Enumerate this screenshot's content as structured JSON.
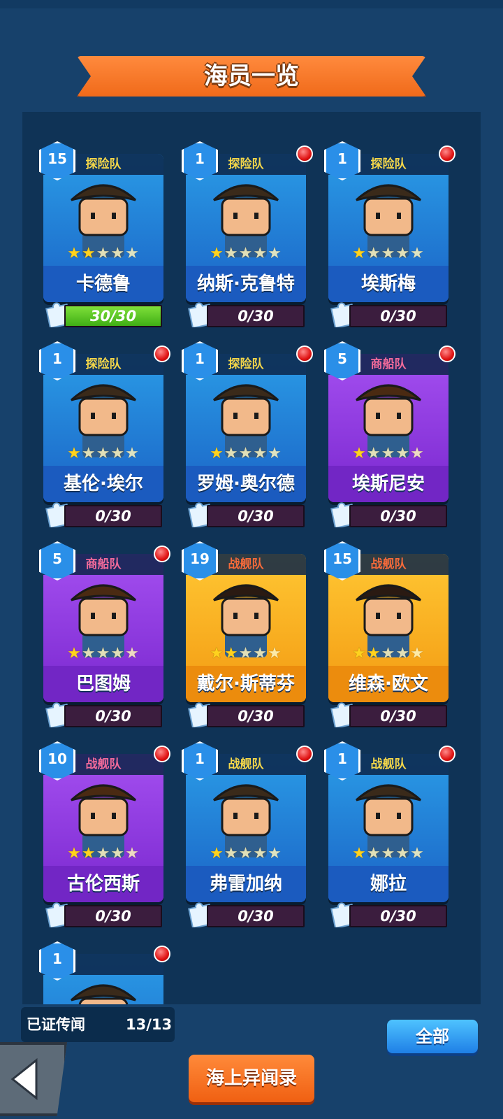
{
  "title": "海员一览",
  "crew": [
    {
      "level": "15",
      "team": "探险队",
      "team_color": "blue",
      "name": "卡德鲁",
      "stars": 2,
      "progress": "30/30",
      "progress_fraction": 1.0,
      "badge": false
    },
    {
      "level": "1",
      "team": "探险队",
      "team_color": "blue",
      "name": "纳斯·克鲁特",
      "stars": 1,
      "progress": "0/30",
      "progress_fraction": 0.0,
      "badge": true
    },
    {
      "level": "1",
      "team": "探险队",
      "team_color": "blue",
      "name": "埃斯梅",
      "stars": 1,
      "progress": "0/30",
      "progress_fraction": 0.0,
      "badge": true
    },
    {
      "level": "1",
      "team": "探险队",
      "team_color": "blue",
      "name": "基伦·埃尔",
      "stars": 1,
      "progress": "0/30",
      "progress_fraction": 0.0,
      "badge": true
    },
    {
      "level": "1",
      "team": "探险队",
      "team_color": "blue",
      "name": "罗姆·奥尔德",
      "stars": 1,
      "progress": "0/30",
      "progress_fraction": 0.0,
      "badge": true
    },
    {
      "level": "5",
      "team": "商船队",
      "team_color": "purple",
      "name": "埃斯尼安",
      "stars": 1,
      "progress": "0/30",
      "progress_fraction": 0.0,
      "badge": true
    },
    {
      "level": "5",
      "team": "商船队",
      "team_color": "purple",
      "name": "巴图姆",
      "stars": 1,
      "progress": "0/30",
      "progress_fraction": 0.0,
      "badge": true
    },
    {
      "level": "19",
      "team": "战舰队",
      "team_color": "orange",
      "name": "戴尔·斯蒂芬",
      "stars": 2,
      "progress": "0/30",
      "progress_fraction": 0.0,
      "badge": false
    },
    {
      "level": "15",
      "team": "战舰队",
      "team_color": "orange",
      "name": "维森·欧文",
      "stars": 2,
      "progress": "0/30",
      "progress_fraction": 0.0,
      "badge": false
    },
    {
      "level": "10",
      "team": "战舰队",
      "team_color": "purple",
      "name": "古伦西斯",
      "stars": 2,
      "progress": "0/30",
      "progress_fraction": 0.0,
      "badge": true
    },
    {
      "level": "1",
      "team": "战舰队",
      "team_color": "blue",
      "name": "弗雷加纳",
      "stars": 1,
      "progress": "0/30",
      "progress_fraction": 0.0,
      "badge": true
    },
    {
      "level": "1",
      "team": "战舰队",
      "team_color": "blue",
      "name": "娜拉",
      "stars": 1,
      "progress": "0/30",
      "progress_fraction": 0.0,
      "badge": true
    },
    {
      "level": "1",
      "team": "",
      "team_color": "blue",
      "name": "",
      "stars": 0,
      "progress": "",
      "progress_fraction": 0.0,
      "badge": true
    }
  ],
  "footer": {
    "verified_label": "已证传闻",
    "verified_count": "13/13",
    "all_label": "全部",
    "book_label": "海上异闻录"
  },
  "icons": {
    "back": "back-arrow-icon",
    "fragment": "puzzle-piece-icon",
    "badge": "red-notification-dot"
  }
}
